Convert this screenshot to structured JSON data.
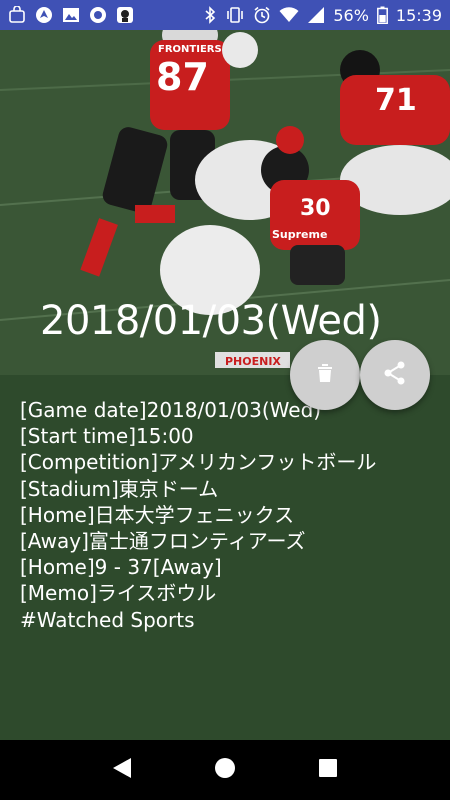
{
  "status_bar": {
    "icons_left": [
      "mobile-shop-icon",
      "navigation-icon",
      "image-icon",
      "record-icon",
      "face-app-icon"
    ],
    "battery": "56%",
    "time": "15:39"
  },
  "header": {
    "date_title": "2018/01/03(Wed)"
  },
  "actions": {
    "delete_icon": "trash-icon",
    "share_icon": "share-icon"
  },
  "details": {
    "lines": [
      "[Game date]2018/01/03(Wed)",
      "[Start time]15:00",
      "[Competition]アメリカンフットボール",
      "[Stadium]東京ドーム",
      "[Home]日本大学フェニックス",
      "[Away]富士通フロンティアーズ",
      "[Home]9 - 37[Away]",
      "[Memo]ライスボウル",
      "#Watched Sports"
    ]
  },
  "photo_text": {
    "jersey_left": "FRONTIERS",
    "jersey_number_left": "87",
    "jersey_number_right": "71",
    "jersey_center": "30",
    "sleeve_text": "Supreme",
    "banner_text": "PHOENIX"
  },
  "colors": {
    "status_bar": "#3f51b5",
    "panel": "#2e4a2c",
    "fab": "#cfcfcf"
  }
}
